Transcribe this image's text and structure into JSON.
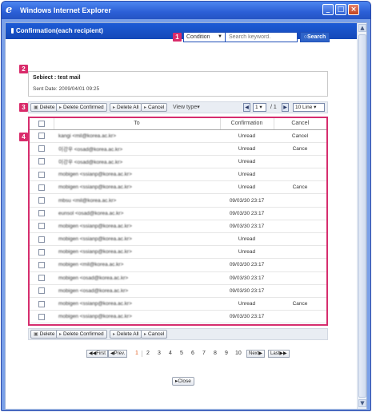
{
  "window": {
    "title": "Windows Internet Explorer",
    "icon": "ie-icon",
    "controls": [
      "minimize",
      "maximize",
      "close"
    ]
  },
  "header": {
    "title": "Confirmation(each recipient)"
  },
  "markers": [
    "1",
    "2",
    "3",
    "4"
  ],
  "search": {
    "condition": "Condition",
    "placeholder": "Search keyword.",
    "button_label": "Search"
  },
  "message": {
    "subject": "Sebiect : test mail",
    "sent_date": "Sent Date: 2009/04/01 09:25"
  },
  "toolbar": {
    "delete": "Delete",
    "delete_confirmed": "Delete Confirmed",
    "delete_all": "Delete All",
    "cancel": "Cancel",
    "view_type": "View type",
    "page_current": "1",
    "page_total": "/ 1",
    "lines": "10 Line"
  },
  "table": {
    "headers": {
      "to": "To",
      "confirmation": "Confirmation",
      "cancel": "Cancel"
    },
    "rows": [
      {
        "to": "kangi  <mil@korea.ac.kr>",
        "confirmation": "Unread",
        "cancel": "Cancel"
      },
      {
        "to": "이강우  <osad@korea.ac.kr>",
        "confirmation": "Unread",
        "cancel": "Cance"
      },
      {
        "to": "이강우  <osad@korea.ac.kr>",
        "confirmation": "Unread",
        "cancel": ""
      },
      {
        "to": "mobigen  <ssianp@korea.ac.kr>",
        "confirmation": "Unread",
        "cancel": ""
      },
      {
        "to": "mobigen  <ssianp@korea.ac.kr>",
        "confirmation": "Unread",
        "cancel": "Cance"
      },
      {
        "to": "mbsu  <mil@korea.ac.kr>",
        "confirmation": "09/03/30 23:17",
        "cancel": ""
      },
      {
        "to": "eunsol  <osad@korea.ac.kr>",
        "confirmation": "09/03/30 23:17",
        "cancel": ""
      },
      {
        "to": "mobigen  <ssianp@korea.ac.kr>",
        "confirmation": "09/03/30 23:17",
        "cancel": ""
      },
      {
        "to": "mobigen  <ssianp@korea.ac.kr>",
        "confirmation": "Unread",
        "cancel": ""
      },
      {
        "to": "mobigen  <ssianp@korea.ac.kr>",
        "confirmation": "Unread",
        "cancel": ""
      },
      {
        "to": "mobigen  <mil@korea.ac.kr>",
        "confirmation": "09/03/30 23:17",
        "cancel": ""
      },
      {
        "to": "mobigen  <osad@korea.ac.kr>",
        "confirmation": "09/03/30 23:17",
        "cancel": ""
      },
      {
        "to": "mobigen  <osad@korea.ac.kr>",
        "confirmation": "09/03/30 23:17",
        "cancel": ""
      },
      {
        "to": "mobigen  <ssianp@korea.ac.kr>",
        "confirmation": "Unread",
        "cancel": "Cance"
      },
      {
        "to": "mobigen  <ssianp@korea.ac.kr>",
        "confirmation": "09/03/30 23:17",
        "cancel": ""
      }
    ]
  },
  "pagination": {
    "first": "First",
    "prev": "Prev.",
    "pages": [
      "1",
      "2",
      "3",
      "4",
      "5",
      "6",
      "7",
      "8",
      "9",
      "10"
    ],
    "current": "1",
    "next": "Next",
    "last": "Last"
  },
  "footer": {
    "close": "Close"
  },
  "colors": {
    "accent": "#1d5bd6",
    "marker": "#d92b6a",
    "current_page": "#e05a1a"
  }
}
